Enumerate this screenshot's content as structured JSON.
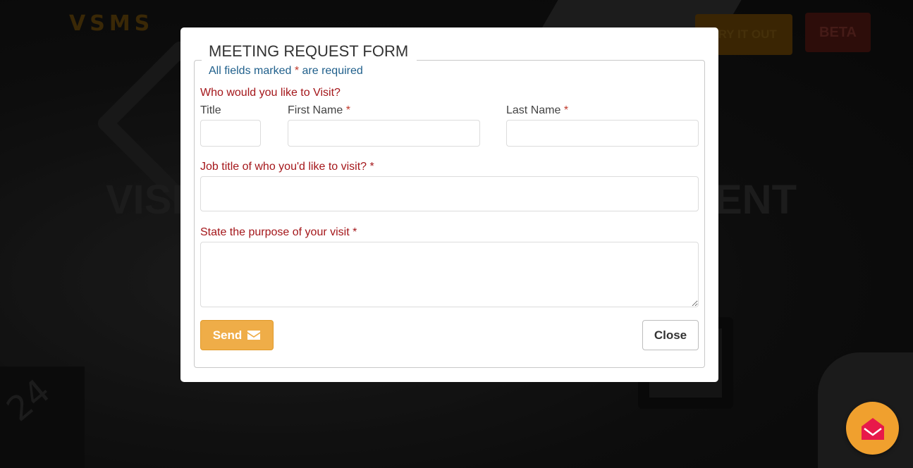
{
  "background": {
    "logo_left": "V",
    "logo_mid": "MS",
    "logo_right": "S",
    "try_label": "TRY IT OUT",
    "beta_label": "BETA",
    "hero_left": "VISI",
    "hero_right": "ENT",
    "side_text": "24"
  },
  "modal": {
    "title": "MEETING REQUEST FORM",
    "required_note_prefix": "All fields marked ",
    "required_note_star": "*",
    "required_note_suffix": " are required",
    "section_visit": "Who would you like to Visit?",
    "label_title": "Title",
    "label_first_name": "First Name",
    "label_last_name": "Last Name",
    "star": "*",
    "label_job_title": "Job title of who you'd like to visit?",
    "label_purpose": "State the purpose of your visit",
    "fields": {
      "title": "",
      "first_name": "",
      "last_name": "",
      "job_title": "",
      "purpose": ""
    },
    "send_label": "Send",
    "close_label": "Close"
  },
  "icons": {
    "send": "envelope-icon",
    "fab": "open-envelope-icon"
  },
  "colors": {
    "accent": "#efad48",
    "required": "#a4161a",
    "note": "#1f5f8b",
    "fab": "#f0a02e",
    "fab_icon": "#e8194a"
  }
}
